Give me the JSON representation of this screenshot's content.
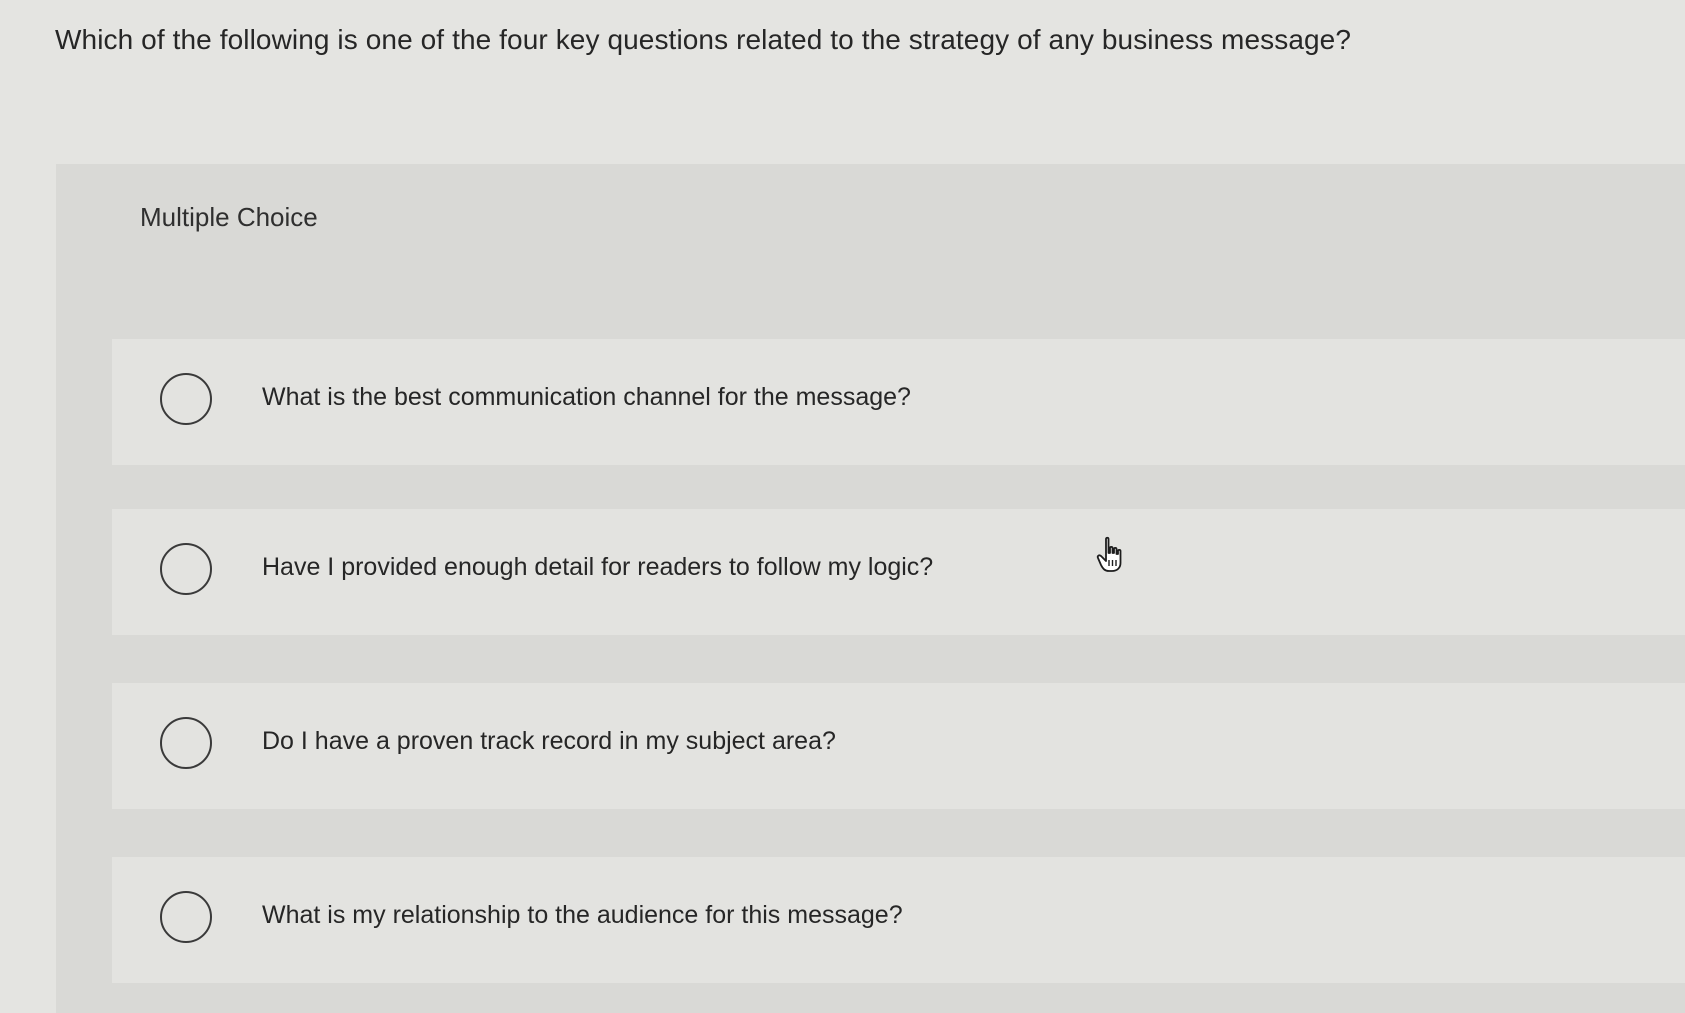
{
  "question": {
    "text": "Which of the following is one of the four key questions related to the strategy of any business message?"
  },
  "panel": {
    "label": "Multiple Choice"
  },
  "options": [
    {
      "text": "What is the best communication channel for the message?",
      "selected": false
    },
    {
      "text": "Have I provided enough detail for readers to follow my logic?",
      "selected": false
    },
    {
      "text": "Do I have a proven track record in my subject area?",
      "selected": false
    },
    {
      "text": "What is my relationship to the audience for this message?",
      "selected": false
    }
  ],
  "cursor": {
    "icon": "hand-pointer-icon"
  },
  "colors": {
    "background": "#e4e4e1",
    "panel": "#d9d9d6",
    "option": "#e3e3e0",
    "text": "#262626"
  }
}
